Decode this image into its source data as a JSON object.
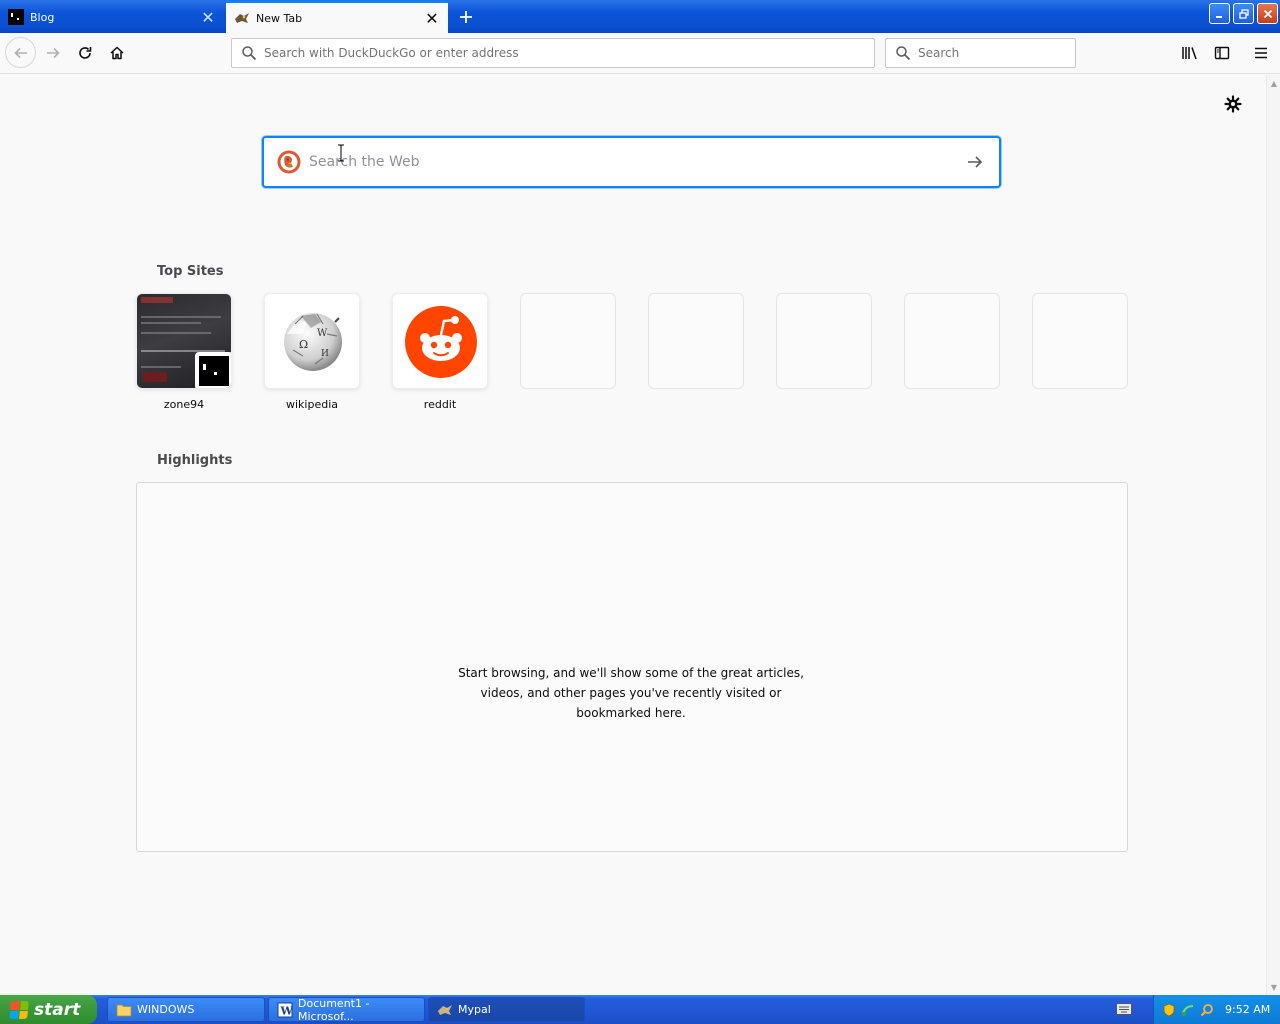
{
  "tabs": [
    {
      "label": "Blog",
      "active": false
    },
    {
      "label": "New Tab",
      "active": true
    }
  ],
  "toolbar": {
    "url_placeholder": "Search with DuckDuckGo or enter address",
    "search_placeholder": "Search"
  },
  "newtab": {
    "search_placeholder": "Search the Web",
    "top_sites_title": "Top Sites",
    "top_sites": [
      {
        "label": "zone94"
      },
      {
        "label": "wikipedia"
      },
      {
        "label": "reddit"
      }
    ],
    "highlights_title": "Highlights",
    "highlights_message": "Start browsing, and we'll show some of the great articles, videos, and other pages you've recently visited or bookmarked here."
  },
  "taskbar": {
    "start_label": "start",
    "items": [
      {
        "label": "WINDOWS",
        "icon": "folder-icon"
      },
      {
        "label": "Document1 - Microsof...",
        "icon": "word-icon"
      },
      {
        "label": "Mypal",
        "icon": "mypal-icon"
      }
    ],
    "clock": "9:52 AM"
  },
  "colors": {
    "accent": "#0a84ff",
    "reddit": "#ff4500",
    "xp_blue": "#245edb",
    "xp_green": "#3c9a3c"
  }
}
